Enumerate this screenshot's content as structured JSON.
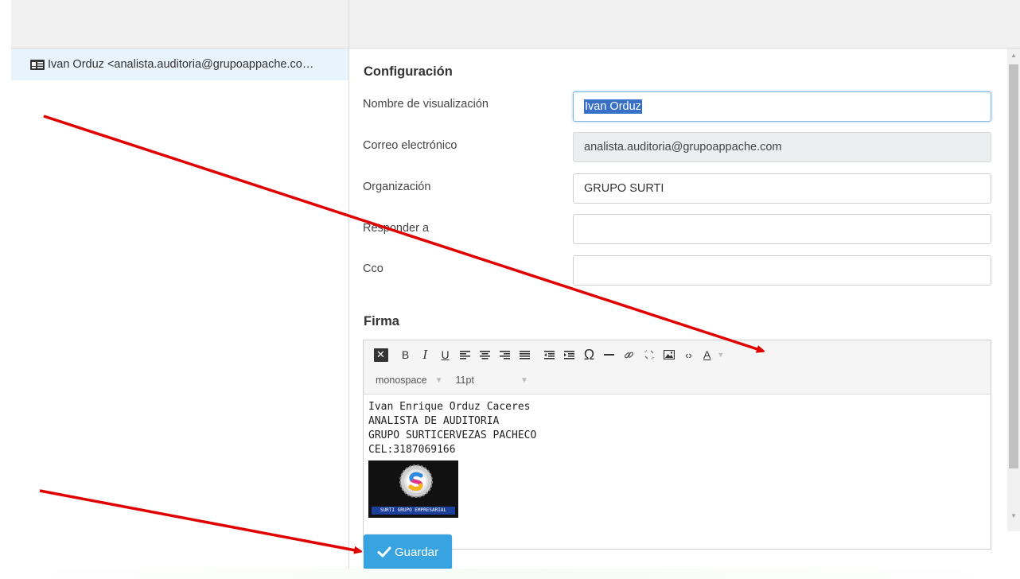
{
  "identity_list": {
    "items": [
      {
        "label": "Ivan Orduz <analista.auditoria@grupoappache.co…",
        "icon": "contact-card-icon"
      }
    ]
  },
  "settings": {
    "section_title": "Configuración",
    "fields": [
      {
        "label": "Nombre de visualización",
        "value": "Ivan Orduz",
        "state": "focused-selected"
      },
      {
        "label": "Correo electrónico",
        "value": "analista.auditoria@grupoappache.com",
        "state": "disabled"
      },
      {
        "label": "Organización",
        "value": "GRUPO SURTI",
        "state": "normal"
      },
      {
        "label": "Responder a",
        "value": "",
        "state": "normal"
      },
      {
        "label": "Cco",
        "value": "",
        "state": "normal"
      }
    ],
    "signature_title": "Firma"
  },
  "editor": {
    "toolbar_icons": [
      "clear-format-icon",
      "bold-icon",
      "italic-icon",
      "underline-icon",
      "align-left-icon",
      "align-center-icon",
      "align-right-icon",
      "align-justify-icon",
      "outdent-icon",
      "indent-icon",
      "special-char-icon",
      "horizontal-rule-icon",
      "link-icon",
      "unlink-icon",
      "image-icon",
      "source-code-icon",
      "text-color-icon"
    ],
    "font_family": "monospace",
    "font_size": "11pt",
    "body_lines": [
      "Ivan Enrique Orduz Caceres",
      "ANALISTA DE AUDITORIA",
      "GRUPO SURTICERVEZAS PACHECO",
      "CEL:3187069166"
    ],
    "logo_caption": "SURTI GRUPO EMPRESARIAL"
  },
  "save_button": {
    "label": "Guardar"
  },
  "colors": {
    "accent": "#37a3e0",
    "selection": "#3870c8",
    "annotation_arrow": "#e00000",
    "list_selected": "#e8f3fb"
  }
}
